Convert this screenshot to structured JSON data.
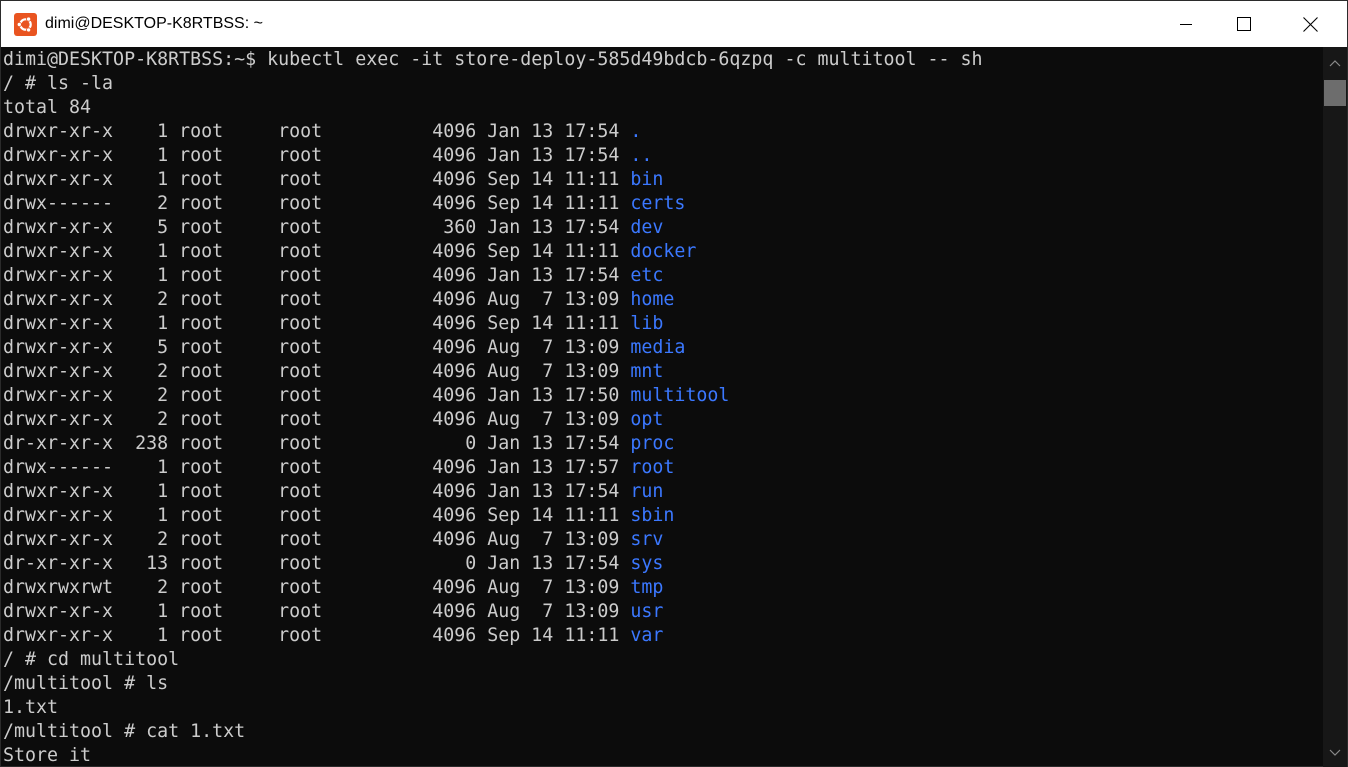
{
  "window": {
    "title": "dimi@DESKTOP-K8RTBSS: ~",
    "app_icon": "ubuntu-logo-icon",
    "controls": [
      "minimize-icon",
      "maximize-icon",
      "close-icon"
    ],
    "accent_color": "#e95420"
  },
  "colors": {
    "background": "#0c0c0c",
    "foreground": "#cccccc",
    "directory": "#3b78ff"
  },
  "terminal": {
    "lines": [
      {
        "text": "dimi@DESKTOP-K8RTBSS:~$ kubectl exec -it store-deploy-585d49bdcb-6qzpq -c multitool -- sh"
      },
      {
        "text": "/ # ls -la"
      },
      {
        "text": "total 84"
      },
      {
        "text": "drwxr-xr-x    1 root     root          4096 Jan 13 17:54 ",
        "name": "."
      },
      {
        "text": "drwxr-xr-x    1 root     root          4096 Jan 13 17:54 ",
        "name": ".."
      },
      {
        "text": "drwxr-xr-x    1 root     root          4096 Sep 14 11:11 ",
        "name": "bin"
      },
      {
        "text": "drwx------    2 root     root          4096 Sep 14 11:11 ",
        "name": "certs"
      },
      {
        "text": "drwxr-xr-x    5 root     root           360 Jan 13 17:54 ",
        "name": "dev"
      },
      {
        "text": "drwxr-xr-x    1 root     root          4096 Sep 14 11:11 ",
        "name": "docker"
      },
      {
        "text": "drwxr-xr-x    1 root     root          4096 Jan 13 17:54 ",
        "name": "etc"
      },
      {
        "text": "drwxr-xr-x    2 root     root          4096 Aug  7 13:09 ",
        "name": "home"
      },
      {
        "text": "drwxr-xr-x    1 root     root          4096 Sep 14 11:11 ",
        "name": "lib"
      },
      {
        "text": "drwxr-xr-x    5 root     root          4096 Aug  7 13:09 ",
        "name": "media"
      },
      {
        "text": "drwxr-xr-x    2 root     root          4096 Aug  7 13:09 ",
        "name": "mnt"
      },
      {
        "text": "drwxr-xr-x    2 root     root          4096 Jan 13 17:50 ",
        "name": "multitool"
      },
      {
        "text": "drwxr-xr-x    2 root     root          4096 Aug  7 13:09 ",
        "name": "opt"
      },
      {
        "text": "dr-xr-xr-x  238 root     root             0 Jan 13 17:54 ",
        "name": "proc"
      },
      {
        "text": "drwx------    1 root     root          4096 Jan 13 17:57 ",
        "name": "root"
      },
      {
        "text": "drwxr-xr-x    1 root     root          4096 Jan 13 17:54 ",
        "name": "run"
      },
      {
        "text": "drwxr-xr-x    1 root     root          4096 Sep 14 11:11 ",
        "name": "sbin"
      },
      {
        "text": "drwxr-xr-x    2 root     root          4096 Aug  7 13:09 ",
        "name": "srv"
      },
      {
        "text": "dr-xr-xr-x   13 root     root             0 Jan 13 17:54 ",
        "name": "sys"
      },
      {
        "text": "drwxrwxrwt    2 root     root          4096 Aug  7 13:09 ",
        "name": "tmp"
      },
      {
        "text": "drwxr-xr-x    1 root     root          4096 Aug  7 13:09 ",
        "name": "usr"
      },
      {
        "text": "drwxr-xr-x    1 root     root          4096 Sep 14 11:11 ",
        "name": "var"
      },
      {
        "text": "/ # cd multitool"
      },
      {
        "text": "/multitool # ls"
      },
      {
        "text": "1.txt"
      },
      {
        "text": "/multitool # cat 1.txt"
      },
      {
        "text": "Store it"
      }
    ]
  }
}
